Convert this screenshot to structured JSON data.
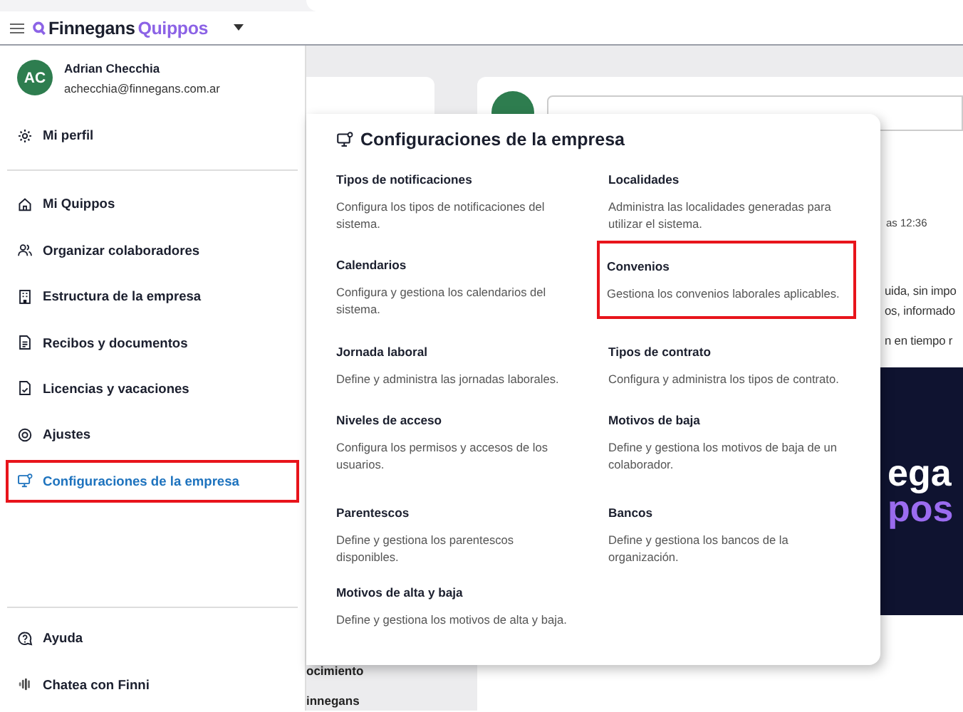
{
  "header": {
    "brand": "Finnegans",
    "brand_suffix": "Quippos"
  },
  "user": {
    "initials": "AC",
    "name": "Adrian Checchia",
    "email": "achecchia@finnegans.com.ar"
  },
  "profile_link": {
    "label": "Mi perfil"
  },
  "nav": [
    {
      "label": "Mi Quippos",
      "selected": false,
      "highlighted": false
    },
    {
      "label": "Organizar colaboradores",
      "selected": false,
      "highlighted": false
    },
    {
      "label": "Estructura de la empresa",
      "selected": false,
      "highlighted": false
    },
    {
      "label": "Recibos y documentos",
      "selected": false,
      "highlighted": false
    },
    {
      "label": "Licencias y vacaciones",
      "selected": false,
      "highlighted": false
    },
    {
      "label": "Ajustes",
      "selected": false,
      "highlighted": false
    },
    {
      "label": "Configuraciones de la empresa",
      "selected": true,
      "highlighted": true
    }
  ],
  "footer_links": [
    {
      "label": "Ayuda"
    },
    {
      "label": "Chatea con Finni"
    }
  ],
  "background": {
    "left_fragments": [
      "ocimiento",
      "innegans"
    ],
    "post_time": "as 12:36",
    "post_lines": [
      "uida, sin impo",
      "os, informado",
      "n en tiempo r"
    ],
    "banner_lines": [
      "ega",
      "pos"
    ]
  },
  "popup": {
    "title": "Configuraciones de la empresa",
    "items": [
      {
        "title": "Tipos de notificaciones",
        "description": "Configura los tipos de notificaciones del sistema.",
        "highlighted": false
      },
      {
        "title": "Localidades",
        "description": "Administra las localidades generadas para utilizar el sistema.",
        "highlighted": false
      },
      {
        "title": "Calendarios",
        "description": "Configura y gestiona los calendarios del sistema.",
        "highlighted": false
      },
      {
        "title": "Convenios",
        "description": "Gestiona los convenios laborales aplicables.",
        "highlighted": true
      },
      {
        "title": "Jornada laboral",
        "description": "Define y administra las jornadas laborales.",
        "highlighted": false
      },
      {
        "title": "Tipos de contrato",
        "description": "Configura y administra los tipos de contrato.",
        "highlighted": false
      },
      {
        "title": "Niveles de acceso",
        "description": "Configura los permisos y accesos de los usuarios.",
        "highlighted": false
      },
      {
        "title": "Motivos de baja",
        "description": "Define y gestiona los motivos de baja de un colaborador.",
        "highlighted": false
      },
      {
        "title": "Parentescos",
        "description": "Define y gestiona los parentescos disponibles.",
        "highlighted": false
      },
      {
        "title": "Bancos",
        "description": "Define y gestiona los bancos de la organización.",
        "highlighted": false
      },
      {
        "title": "Motivos de alta y baja",
        "description": "Define y gestiona los motivos de alta y baja.",
        "highlighted": false
      }
    ]
  }
}
